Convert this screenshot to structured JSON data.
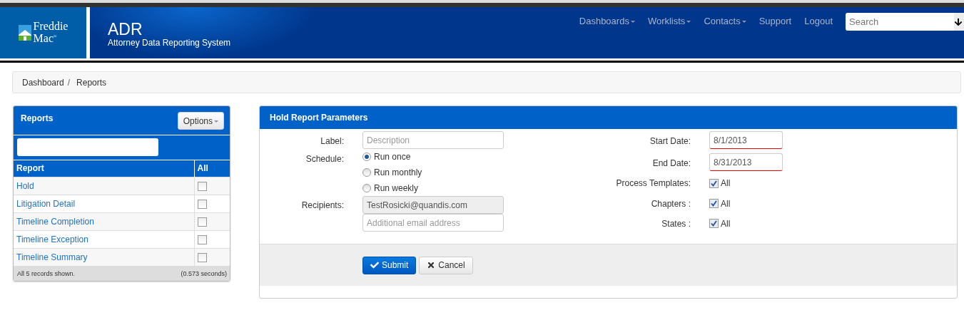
{
  "logo": {
    "line_1": "Freddie",
    "line_2": "Mac",
    "mark": "®"
  },
  "app": {
    "title": "ADR",
    "subtitle": "Attorney Data Reporting System"
  },
  "nav": [
    {
      "label": "Dashboards",
      "dropdown": true
    },
    {
      "label": "Worklists",
      "dropdown": true
    },
    {
      "label": "Contacts",
      "dropdown": true
    },
    {
      "label": "Support",
      "dropdown": false
    },
    {
      "label": "Logout",
      "dropdown": false
    }
  ],
  "search": {
    "placeholder": "Search"
  },
  "breadcrumb": [
    "Dashboard",
    "Reports"
  ],
  "breadcrumb_separator": "/",
  "reports_panel": {
    "title": "Reports",
    "options_button": "Options",
    "columns": [
      "Report",
      "All"
    ],
    "rows": [
      {
        "name": "Hold",
        "checked": false
      },
      {
        "name": "Litigation Detail",
        "checked": false
      },
      {
        "name": "Timeline Completion",
        "checked": false
      },
      {
        "name": "Timeline Exception",
        "checked": false
      },
      {
        "name": "Timeline Summary",
        "checked": false
      }
    ],
    "footer_count": "All 5 records shown.",
    "footer_time": "(0.573 seconds)"
  },
  "parameters_panel": {
    "title": "Hold Report Parameters",
    "label_field": {
      "label": "Label:",
      "placeholder": "Description"
    },
    "schedule": {
      "label": "Schedule:",
      "options": [
        {
          "label": "Run once",
          "selected": true
        },
        {
          "label": "Run monthly",
          "selected": false
        },
        {
          "label": "Run weekly",
          "selected": false
        }
      ]
    },
    "recipients": {
      "label": "Recipients:",
      "value": "TestRosicki@quandis.com",
      "placeholder": "Additional email address"
    },
    "dates": [
      {
        "label": "Start Date:",
        "value": "8/1/2013",
        "error": true
      },
      {
        "label": "End Date:",
        "value": "8/31/2013",
        "error": true
      }
    ],
    "filters": [
      {
        "label": "Process Templates:",
        "option": "All",
        "checked": true
      },
      {
        "label": "Chapters :",
        "option": "All",
        "checked": true
      },
      {
        "label": "States :",
        "option": "All",
        "checked": true
      }
    ],
    "buttons": [
      {
        "kind": "primary",
        "label": "Submit"
      },
      {
        "kind": "default",
        "label": "Cancel"
      }
    ]
  }
}
